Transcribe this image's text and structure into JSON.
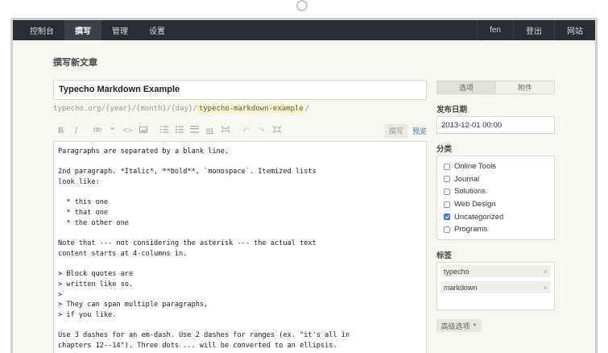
{
  "nav": {
    "left": [
      "控制台",
      "撰写",
      "管理",
      "设置"
    ],
    "right": [
      "fen",
      "登出",
      "网站"
    ]
  },
  "page_title": "撰写新文章",
  "post": {
    "title": "Typecho Markdown Example",
    "slug_prefix": "typecho.org/{year}/{month}/{day}/",
    "slug": "typecho-markdown-example",
    "slug_suffix": "/"
  },
  "toolbar": {
    "icons": [
      "bold-icon",
      "italic-icon",
      "link-icon",
      "quote-icon",
      "code-icon",
      "image-icon",
      "ordered-list-icon",
      "unordered-list-icon",
      "heading-icon",
      "horizontal-rule-icon",
      "more-icon",
      "undo-icon",
      "redo-icon",
      "fullscreen-icon"
    ],
    "write_label": "撰写",
    "preview_label": "预览"
  },
  "editor_lines": [
    "Paragraphs are separated by a blank line.",
    "",
    "2nd paragraph. *Italic*, **bold**, `monospace`. Itemized lists",
    "look like:",
    "",
    "  * this one",
    "  * that one",
    "  * the other one",
    "",
    "Note that --- not considering the asterisk --- the actual text",
    "content starts at 4-columns in.",
    "",
    "> Block quotes are",
    "> written like so.",
    ">",
    "> They can span multiple paragraphs,",
    "> if you like.",
    "",
    "Use 3 dashes for an em-dash. Use 2 dashes for ranges (ex. \"it's all in",
    "chapters 12--14\"). Three dots ... will be converted to an ellipsis."
  ],
  "sidebar": {
    "tabs": [
      "选项",
      "附件"
    ],
    "date_label": "发布日期",
    "date_value": "2013-12-01 00:00",
    "category_label": "分类",
    "categories": [
      {
        "name": "Online Tools",
        "checked": false
      },
      {
        "name": "Journal",
        "checked": false
      },
      {
        "name": "Solutions",
        "checked": false
      },
      {
        "name": "Web Design",
        "checked": false
      },
      {
        "name": "Uncategorized",
        "checked": true
      },
      {
        "name": "Programs",
        "checked": false
      }
    ],
    "tag_label": "标签",
    "tags": [
      "typecho",
      "markdown"
    ],
    "advanced_label": "高级选项"
  },
  "colors": {
    "navbar": "#292d33",
    "background": "#f6f6f3",
    "link": "#467b96",
    "slug_highlight": "#fbf4c6"
  }
}
